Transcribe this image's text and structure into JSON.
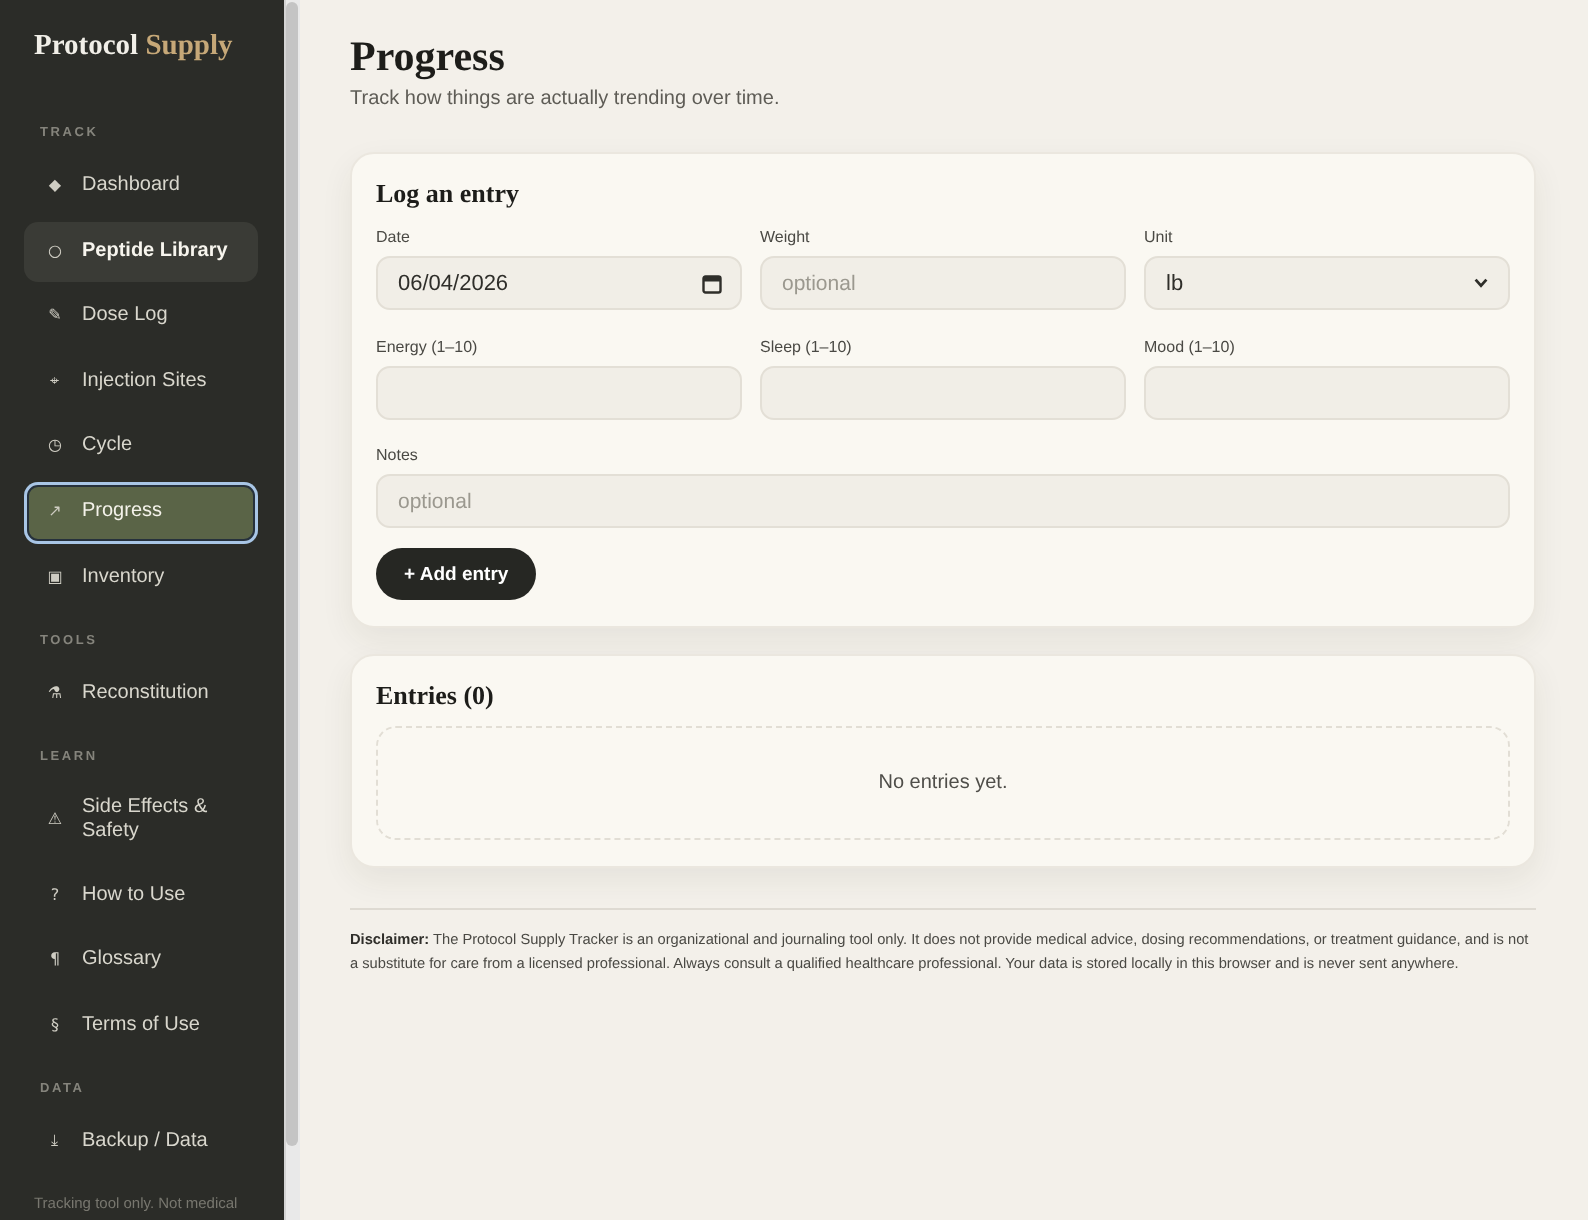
{
  "brand": {
    "primary": "Protocol",
    "accent": "Supply"
  },
  "sidebar": {
    "sections": [
      {
        "heading": "TRACK",
        "items": [
          {
            "icon": "◆",
            "label": "Dashboard",
            "selected": false,
            "hovered": false
          },
          {
            "icon": "○",
            "label": "Peptide Library",
            "selected": false,
            "hovered": true
          },
          {
            "icon": "✎",
            "label": "Dose Log",
            "selected": false,
            "hovered": false
          },
          {
            "icon": "⌖",
            "label": "Injection Sites",
            "selected": false,
            "hovered": false
          },
          {
            "icon": "◷",
            "label": "Cycle",
            "selected": false,
            "hovered": false
          },
          {
            "icon": "↗",
            "label": "Progress",
            "selected": true,
            "hovered": false
          },
          {
            "icon": "▣",
            "label": "Inventory",
            "selected": false,
            "hovered": false
          }
        ]
      },
      {
        "heading": "TOOLS",
        "items": [
          {
            "icon": "⚗",
            "label": "Reconstitution",
            "selected": false,
            "hovered": false
          }
        ]
      },
      {
        "heading": "LEARN",
        "items": [
          {
            "icon": "⚠",
            "label": "Side Effects & Safety",
            "selected": false,
            "hovered": false
          },
          {
            "icon": "?",
            "label": "How to Use",
            "selected": false,
            "hovered": false
          },
          {
            "icon": "¶",
            "label": "Glossary",
            "selected": false,
            "hovered": false
          },
          {
            "icon": "§",
            "label": "Terms of Use",
            "selected": false,
            "hovered": false
          }
        ]
      },
      {
        "heading": "DATA",
        "items": [
          {
            "icon": "⤓",
            "label": "Backup / Data",
            "selected": false,
            "hovered": false
          }
        ]
      }
    ],
    "footer_note": "Tracking tool only. Not medical"
  },
  "page": {
    "title": "Progress",
    "subtitle": "Track how things are actually trending over time."
  },
  "log_form": {
    "title": "Log an entry",
    "fields": [
      {
        "kind": "date",
        "label": "Date",
        "value": "06/04/2026",
        "wide": false
      },
      {
        "kind": "text",
        "label": "Weight",
        "placeholder": "optional",
        "wide": false
      },
      {
        "kind": "select",
        "label": "Unit",
        "value": "lb",
        "wide": false
      },
      {
        "kind": "text",
        "label": "Energy (1–10)",
        "wide": false
      },
      {
        "kind": "text",
        "label": "Sleep (1–10)",
        "wide": false
      },
      {
        "kind": "text",
        "label": "Mood (1–10)",
        "wide": false
      },
      {
        "kind": "text",
        "label": "Notes",
        "placeholder": "optional",
        "wide": true
      }
    ],
    "submit_button": "+ Add entry"
  },
  "entries": {
    "title": "Entries (0)",
    "empty_message": "No entries yet."
  },
  "disclaimer": "**Disclaimer:** The Protocol Supply Tracker is an organizational and journaling tool only. It does not provide medical advice, dosing recommendations, or treatment guidance, and is not a substitute for care from a licensed professional. Always consult a qualified healthcare professional. Your data is stored locally in this browser and is never sent anywhere."
}
